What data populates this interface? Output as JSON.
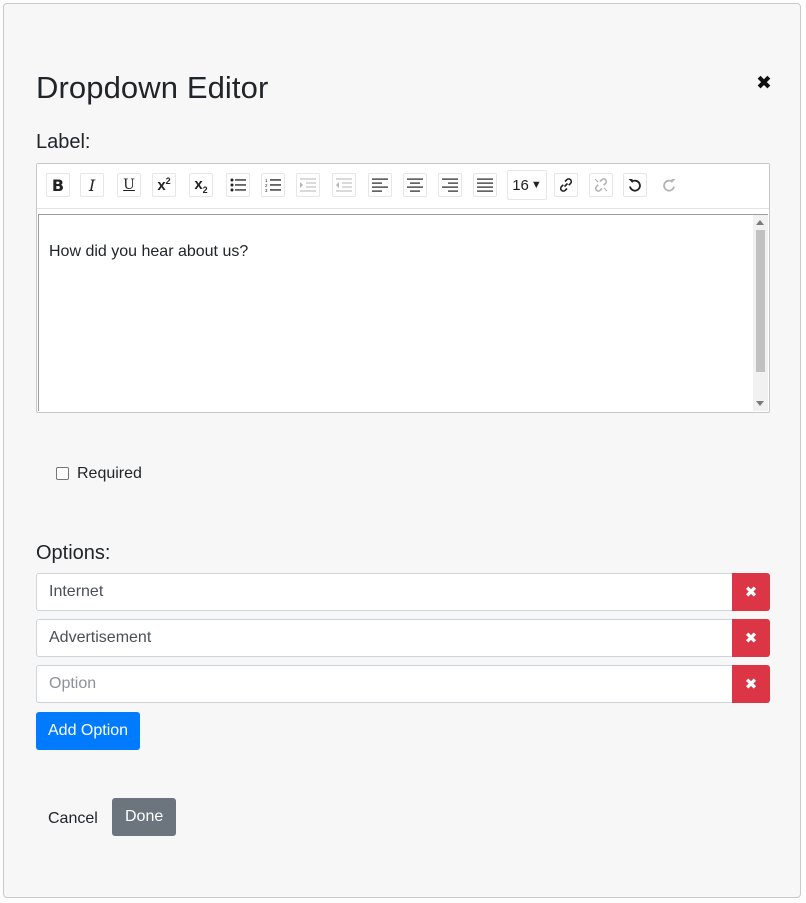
{
  "modal": {
    "title": "Dropdown Editor",
    "close_icon": "close-icon"
  },
  "label_section": {
    "label": "Label:",
    "editor_text": "How did you hear about us?",
    "font_size_value": "16",
    "toolbar_icons": [
      "bold-icon",
      "italic-icon",
      "underline-icon",
      "superscript-icon",
      "subscript-icon",
      "bullet-list-icon",
      "numbered-list-icon",
      "indent-icon",
      "outdent-icon",
      "align-left-icon",
      "align-center-icon",
      "align-right-icon",
      "justify-icon",
      "font-size-select",
      "link-icon",
      "unlink-icon",
      "undo-icon",
      "redo-icon"
    ]
  },
  "required": {
    "label": "Required",
    "checked": false
  },
  "options_section": {
    "label": "Options:",
    "options": [
      {
        "value": "Internet",
        "placeholder": "Option"
      },
      {
        "value": "Advertisement",
        "placeholder": "Option"
      },
      {
        "value": "",
        "placeholder": "Option"
      }
    ],
    "delete_icon": "close-icon",
    "add_button": "Add Option"
  },
  "footer": {
    "cancel": "Cancel",
    "done": "Done"
  },
  "colors": {
    "danger": "#dc3545",
    "primary": "#007bff",
    "secondary": "#6c757d"
  }
}
